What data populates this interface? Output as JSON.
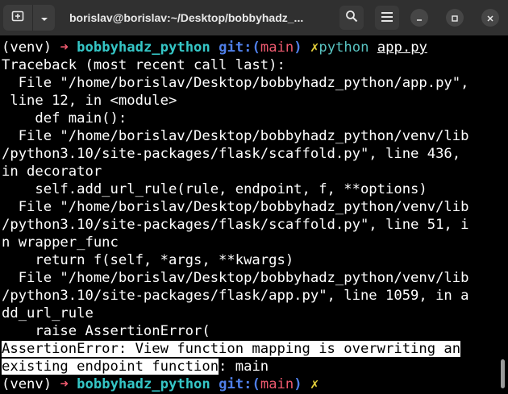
{
  "window": {
    "title": "borislav@borislav:~/Desktop/bobbyhadz_...",
    "icons": {
      "new_tab": "new-tab-icon",
      "tab_menu": "chevron-down-icon",
      "search": "search-icon",
      "menu": "hamburger-menu-icon",
      "minimize": "minimize-icon",
      "maximize": "maximize-icon",
      "close": "close-icon"
    }
  },
  "colors": {
    "background": "#000000",
    "titlebar": "#303030",
    "prompt_arrow": "#ef5a6f",
    "prompt_dir": "#35c6c6",
    "prompt_git": "#4f7fe8",
    "prompt_dirty": "#e6d13a",
    "command": "#58c2c0"
  },
  "prompt": {
    "venv": "(venv)",
    "arrow": "➜",
    "dir": "bobbyhadz_python",
    "git_prefix": "git:(",
    "branch": "main",
    "git_suffix": ")",
    "dirty": "✗",
    "command": "python",
    "argument": "app.py"
  },
  "output": [
    "Traceback (most recent call last):",
    "  File \"/home/borislav/Desktop/bobbyhadz_python/app.py\",",
    " line 12, in <module>",
    "    def main():",
    "  File \"/home/borislav/Desktop/bobbyhadz_python/venv/lib",
    "/python3.10/site-packages/flask/scaffold.py\", line 436,",
    "in decorator",
    "    self.add_url_rule(rule, endpoint, f, **options)",
    "  File \"/home/borislav/Desktop/bobbyhadz_python/venv/lib",
    "/python3.10/site-packages/flask/scaffold.py\", line 51, i",
    "n wrapper_func",
    "    return f(self, *args, **kwargs)",
    "  File \"/home/borislav/Desktop/bobbyhadz_python/venv/lib",
    "/python3.10/site-packages/flask/app.py\", line 1059, in a",
    "dd_url_rule",
    "    raise AssertionError("
  ],
  "error": {
    "line1": "AssertionError: View function mapping is overwriting an",
    "line2_highlighted": "existing endpoint function",
    "line2_rest": ": main"
  }
}
